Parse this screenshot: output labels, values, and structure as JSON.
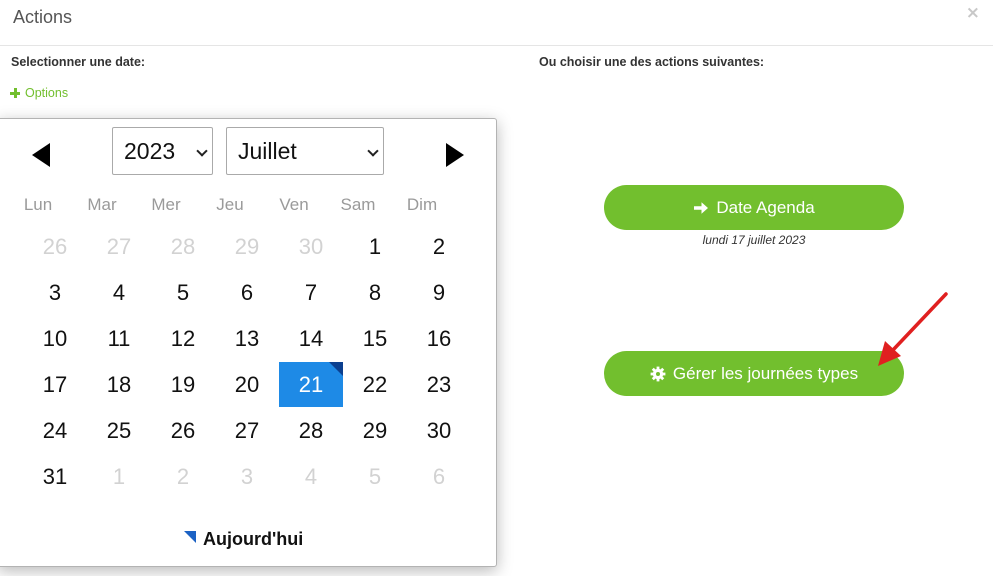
{
  "modal": {
    "title": "Actions",
    "close_glyph": "×"
  },
  "left": {
    "heading": "Selectionner une date:",
    "options_label": "Options"
  },
  "right": {
    "heading": "Ou choisir une des actions suivantes:"
  },
  "calendar": {
    "year": "2023",
    "month": "Juillet",
    "weekdays": [
      "Lun",
      "Mar",
      "Mer",
      "Jeu",
      "Ven",
      "Sam",
      "Dim"
    ],
    "weeks": [
      [
        {
          "d": "26",
          "m": true
        },
        {
          "d": "27",
          "m": true
        },
        {
          "d": "28",
          "m": true
        },
        {
          "d": "29",
          "m": true
        },
        {
          "d": "30",
          "m": true
        },
        {
          "d": "1"
        },
        {
          "d": "2"
        }
      ],
      [
        {
          "d": "3"
        },
        {
          "d": "4"
        },
        {
          "d": "5"
        },
        {
          "d": "6"
        },
        {
          "d": "7"
        },
        {
          "d": "8"
        },
        {
          "d": "9"
        }
      ],
      [
        {
          "d": "10"
        },
        {
          "d": "11"
        },
        {
          "d": "12"
        },
        {
          "d": "13"
        },
        {
          "d": "14"
        },
        {
          "d": "15"
        },
        {
          "d": "16"
        }
      ],
      [
        {
          "d": "17"
        },
        {
          "d": "18"
        },
        {
          "d": "19"
        },
        {
          "d": "20"
        },
        {
          "d": "21",
          "sel": true
        },
        {
          "d": "22"
        },
        {
          "d": "23"
        }
      ],
      [
        {
          "d": "24"
        },
        {
          "d": "25"
        },
        {
          "d": "26"
        },
        {
          "d": "27"
        },
        {
          "d": "28"
        },
        {
          "d": "29"
        },
        {
          "d": "30"
        }
      ],
      [
        {
          "d": "31"
        },
        {
          "d": "1",
          "m": true
        },
        {
          "d": "2",
          "m": true
        },
        {
          "d": "3",
          "m": true
        },
        {
          "d": "4",
          "m": true
        },
        {
          "d": "5",
          "m": true
        },
        {
          "d": "6",
          "m": true
        }
      ]
    ],
    "today_label": "Aujourd'hui"
  },
  "actions": {
    "date_agenda": {
      "label": "Date Agenda",
      "icon": "arrow-right-icon",
      "caption": "lundi 17 juillet 2023"
    },
    "journees_types": {
      "label": "Gérer les journées types",
      "icon": "gear-icon"
    }
  },
  "colors": {
    "accent_green": "#72bf2e",
    "selected_blue": "#1e8ae6",
    "annotation_red": "#e02020"
  }
}
